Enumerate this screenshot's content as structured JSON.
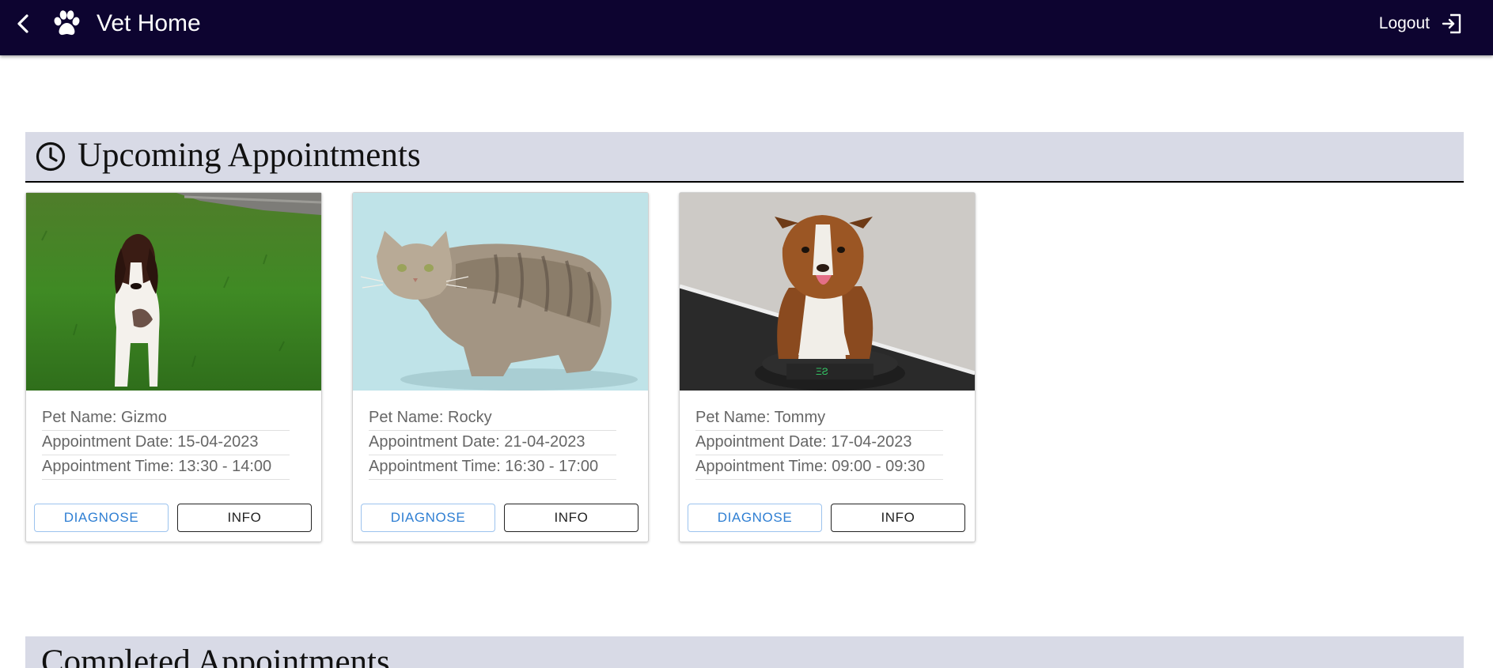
{
  "appbar": {
    "title": "Vet Home",
    "back_icon": "chevron-left-icon",
    "logo_icon": "paw-icon",
    "logout_label": "Logout",
    "logout_icon": "logout-icon",
    "background": "#0d0430"
  },
  "upcoming": {
    "title": "Upcoming Appointments",
    "icon": "clock-icon",
    "appointments": [
      {
        "photo": "dog-photo",
        "pet_name": "Pet Name: Gizmo",
        "date": "Appointment Date: 15-04-2023",
        "time": "Appointment Time: 13:30 - 14:00",
        "diagnose_label": "DIAGNOSE",
        "info_label": "INFO"
      },
      {
        "photo": "cat-photo",
        "pet_name": "Pet Name: Rocky",
        "date": "Appointment Date: 21-04-2023",
        "time": "Appointment Time: 16:30 - 17:00",
        "diagnose_label": "DIAGNOSE",
        "info_label": "INFO"
      },
      {
        "photo": "dog-photo",
        "pet_name": "Pet Name: Tommy",
        "date": "Appointment Date: 17-04-2023",
        "time": "Appointment Time: 09:00 - 09:30",
        "diagnose_label": "DIAGNOSE",
        "info_label": "INFO"
      }
    ]
  },
  "completed": {
    "title": "Completed Appointments"
  },
  "colors": {
    "section_header_bg": "#d8dae6",
    "diagnose_accent": "#2f7fd3"
  }
}
